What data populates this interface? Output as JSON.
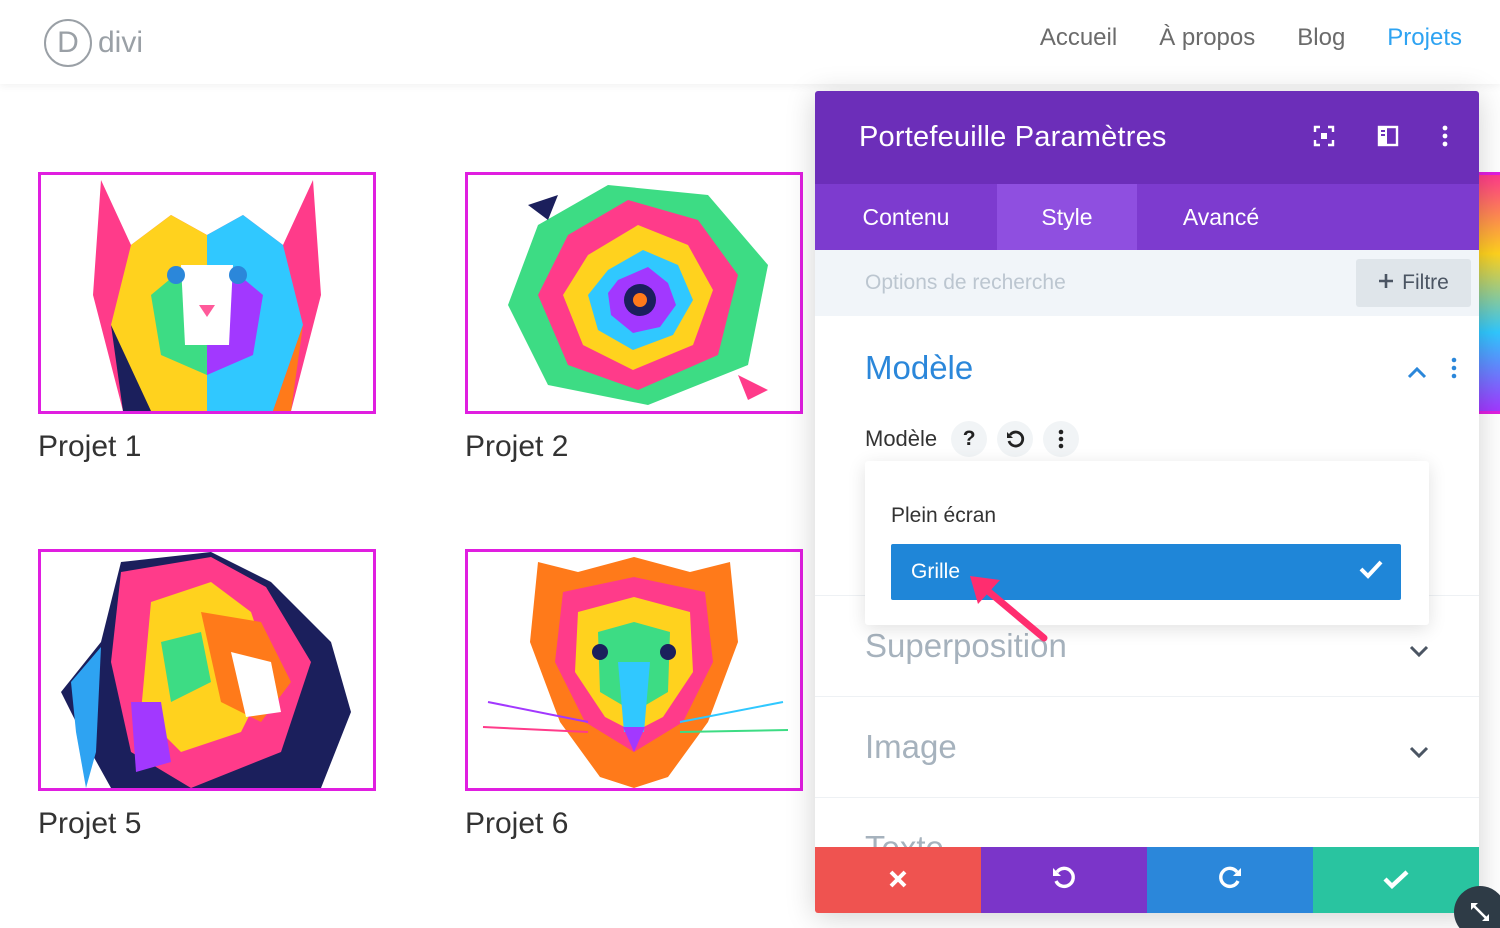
{
  "logo": {
    "letter": "D",
    "text": "divi"
  },
  "nav": {
    "items": [
      "Accueil",
      "À propos",
      "Blog",
      "Projets"
    ],
    "active": "Projets"
  },
  "gallery": {
    "cards": [
      {
        "title": "Projet 1",
        "image": "colorful-cat-illustration"
      },
      {
        "title": "Projet 2",
        "image": "colorful-rose-illustration"
      },
      {
        "title": "Projet 5",
        "image": "colorful-lion-illustration"
      },
      {
        "title": "Projet 6",
        "image": "colorful-tiger-illustration"
      }
    ],
    "border_color": "#e01ee0"
  },
  "panel": {
    "title": "Portefeuille Paramètres",
    "header_icons": [
      "expand-icon",
      "sidebar-layout-icon",
      "more-vertical-icon"
    ],
    "tabs": [
      "Contenu",
      "Style",
      "Avancé"
    ],
    "active_tab": "Style",
    "search_placeholder": "Options de recherche",
    "filter_label": "Filtre",
    "sections": {
      "modele": {
        "title": "Modèle",
        "expanded": true
      },
      "superposition": {
        "title": "Superposition"
      },
      "image": {
        "title": "Image"
      },
      "texte": {
        "title": "Texte"
      }
    },
    "field": {
      "label": "Modèle",
      "help": "?"
    },
    "dropdown": {
      "options": [
        "Plein écran",
        "Grille"
      ],
      "selected": "Grille"
    },
    "footer": [
      "cancel",
      "undo",
      "redo",
      "save"
    ]
  },
  "colors": {
    "header": "#6c2eb9",
    "tabs": "#7d3bcf",
    "accent": "#2b87da",
    "selected": "#1f86d8",
    "cancel": "#ef5350",
    "save": "#29c4a0",
    "arrow": "#ff2d6f",
    "nav_active": "#2ea3f2"
  }
}
